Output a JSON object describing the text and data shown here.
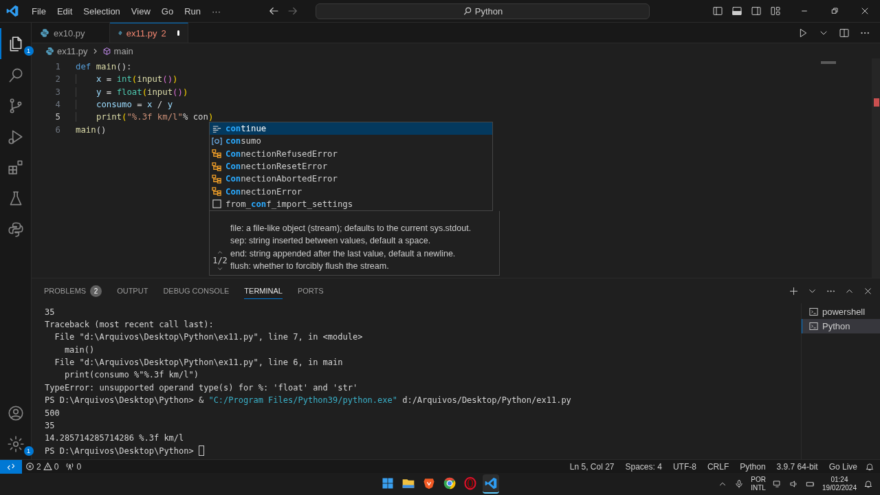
{
  "menu": [
    "File",
    "Edit",
    "Selection",
    "View",
    "Go",
    "Run",
    "···"
  ],
  "command_center": {
    "value": "Python"
  },
  "activity_bar": [
    {
      "kind": "explorer",
      "badge": "1",
      "selected": true
    },
    {
      "kind": "search",
      "selected": false
    },
    {
      "kind": "source-control",
      "selected": false
    },
    {
      "kind": "run-debug",
      "selected": false
    },
    {
      "kind": "extensions",
      "selected": false
    },
    {
      "kind": "testing",
      "selected": false
    },
    {
      "kind": "python",
      "selected": false
    }
  ],
  "activity_bottom": [
    {
      "kind": "account"
    },
    {
      "kind": "settings",
      "badge": "1"
    }
  ],
  "tabs": [
    {
      "label": "ex10.py",
      "selected": false,
      "modified": false
    },
    {
      "label": "ex11.py",
      "problems": "2",
      "selected": true,
      "modified": true
    }
  ],
  "breadcrumb": {
    "file": "ex11.py",
    "symbol": "main"
  },
  "code_lines": [
    {
      "number": "1",
      "current": false,
      "indent": false,
      "tokens": [
        {
          "text": "def ",
          "kind": "keyword"
        },
        {
          "text": "main",
          "kind": "function"
        },
        {
          "text": "():",
          "kind": "plain"
        }
      ]
    },
    {
      "number": "2",
      "current": false,
      "indent": true,
      "tokens": [
        {
          "text": "x",
          "kind": "variable"
        },
        {
          "text": " = ",
          "kind": "plain"
        },
        {
          "text": "int",
          "kind": "type"
        },
        {
          "text": "(",
          "kind": "bracket"
        },
        {
          "text": "input",
          "kind": "function"
        },
        {
          "text": "()",
          "kind": "bracket2"
        },
        {
          "text": ")",
          "kind": "bracket"
        }
      ]
    },
    {
      "number": "3",
      "current": false,
      "indent": true,
      "tokens": [
        {
          "text": "y",
          "kind": "variable"
        },
        {
          "text": " = ",
          "kind": "plain"
        },
        {
          "text": "float",
          "kind": "type"
        },
        {
          "text": "(",
          "kind": "bracket"
        },
        {
          "text": "input",
          "kind": "function"
        },
        {
          "text": "()",
          "kind": "bracket2"
        },
        {
          "text": ")",
          "kind": "bracket"
        }
      ]
    },
    {
      "number": "4",
      "current": false,
      "indent": true,
      "tokens": [
        {
          "text": "consumo",
          "kind": "variable"
        },
        {
          "text": " = ",
          "kind": "plain"
        },
        {
          "text": "x",
          "kind": "variable"
        },
        {
          "text": " / ",
          "kind": "plain"
        },
        {
          "text": "y",
          "kind": "variable"
        }
      ]
    },
    {
      "number": "5",
      "current": true,
      "indent": true,
      "tokens": [
        {
          "text": "print",
          "kind": "function"
        },
        {
          "text": "(",
          "kind": "bracket"
        },
        {
          "text": "\"%.3f km/l\"",
          "kind": "string"
        },
        {
          "text": "% con",
          "kind": "plain"
        },
        {
          "text": ")",
          "kind": "bracket"
        }
      ]
    },
    {
      "number": "6",
      "current": false,
      "indent": false,
      "tokens": [
        {
          "text": "main",
          "kind": "function"
        },
        {
          "text": "()",
          "kind": "plain"
        }
      ]
    }
  ],
  "suggestions": [
    {
      "kind": "keyword",
      "match": "con",
      "after": "tinue",
      "selected": true
    },
    {
      "kind": "variable",
      "match": "con",
      "after": "sumo",
      "selected": false
    },
    {
      "kind": "class",
      "match": "Con",
      "after": "nectionRefusedError",
      "selected": false
    },
    {
      "kind": "class",
      "match": "Con",
      "after": "nectionResetError",
      "selected": false
    },
    {
      "kind": "class",
      "match": "Con",
      "after": "nectionAbortedError",
      "selected": false
    },
    {
      "kind": "class",
      "match": "Con",
      "after": "nectionError",
      "selected": false
    },
    {
      "kind": "text",
      "before": "from_",
      "match": "con",
      "after": "f_import_settings",
      "selected": false
    }
  ],
  "signature_help": {
    "counter": "1/2",
    "lines": [
      "file: a file-like object (stream); defaults to the current sys.stdout.",
      "sep: string inserted between values, default a space.",
      "end: string appended after the last value, default a newline.",
      "flush: whether to forcibly flush the stream."
    ]
  },
  "panel_tabs": [
    {
      "label": "PROBLEMS",
      "badge": "2",
      "selected": false
    },
    {
      "label": "OUTPUT",
      "selected": false
    },
    {
      "label": "DEBUG CONSOLE",
      "selected": false
    },
    {
      "label": "TERMINAL",
      "selected": true
    },
    {
      "label": "PORTS",
      "selected": false
    }
  ],
  "terminal_lines": [
    {
      "parts": [
        {
          "text": "35",
          "kind": "plain"
        }
      ]
    },
    {
      "parts": [
        {
          "text": "Traceback (most recent call last):",
          "kind": "plain"
        }
      ]
    },
    {
      "parts": [
        {
          "text": "  File \"d:\\Arquivos\\Desktop\\Python\\ex11.py\", line 7, in <module>",
          "kind": "plain"
        }
      ]
    },
    {
      "parts": [
        {
          "text": "    main()",
          "kind": "plain"
        }
      ]
    },
    {
      "parts": [
        {
          "text": "  File \"d:\\Arquivos\\Desktop\\Python\\ex11.py\", line 6, in main",
          "kind": "plain"
        }
      ]
    },
    {
      "parts": [
        {
          "text": "    print(consumo %\"%.3f km/l\")",
          "kind": "plain"
        }
      ]
    },
    {
      "parts": [
        {
          "text": "TypeError: unsupported operand type(s) for %: 'float' and 'str'",
          "kind": "plain"
        }
      ]
    },
    {
      "parts": [
        {
          "text": "PS D:\\Arquivos\\Desktop\\Python> & ",
          "kind": "plain"
        },
        {
          "text": "\"C:/Program Files/Python39/python.exe\"",
          "kind": "string"
        },
        {
          "text": " d:/Arquivos/Desktop/Python/ex11.py",
          "kind": "plain"
        }
      ]
    },
    {
      "parts": [
        {
          "text": "500",
          "kind": "plain"
        }
      ]
    },
    {
      "parts": [
        {
          "text": "35",
          "kind": "plain"
        }
      ]
    },
    {
      "parts": [
        {
          "text": "14.285714285714286 %.3f km/l",
          "kind": "plain"
        }
      ]
    },
    {
      "parts": [
        {
          "text": "PS D:\\Arquivos\\Desktop\\Python> ",
          "kind": "plain"
        }
      ],
      "cursor": true
    }
  ],
  "terminals": [
    {
      "label": "powershell",
      "selected": false
    },
    {
      "label": "Python",
      "selected": true
    }
  ],
  "status_left": {
    "errors": "2",
    "warnings": "0",
    "ports": "0"
  },
  "status_right": [
    "Ln 5, Col 27",
    "Spaces: 4",
    "UTF-8",
    "CRLF",
    "Python",
    "3.9.7 64-bit",
    "Go Live"
  ],
  "taskbar": {
    "apps": [
      {
        "kind": "start",
        "selected": false
      },
      {
        "kind": "folder",
        "selected": false
      },
      {
        "kind": "brave",
        "selected": false
      },
      {
        "kind": "chrome",
        "selected": false
      },
      {
        "kind": "opera",
        "selected": false
      },
      {
        "kind": "vscode",
        "selected": true
      }
    ],
    "language": "POR",
    "layout": "INTL",
    "time": "01:24",
    "date": "19/02/2024"
  }
}
